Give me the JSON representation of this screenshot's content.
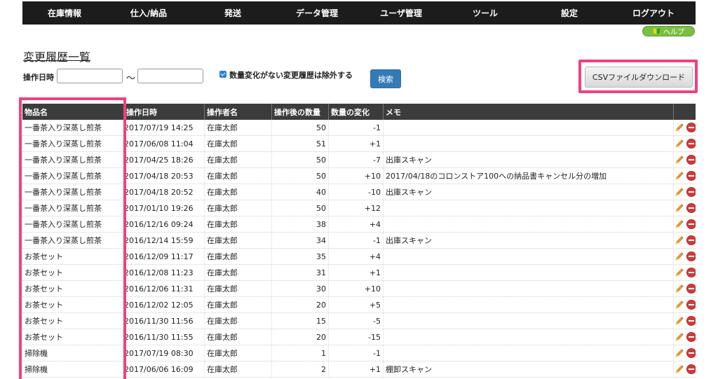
{
  "nav": {
    "items": [
      "在庫情報",
      "仕入/納品",
      "発送",
      "データ管理",
      "ユーザ管理",
      "ツール",
      "設定",
      "ログアウト"
    ]
  },
  "help": {
    "label": "ヘルプ"
  },
  "page": {
    "title": "変更履歴一覧"
  },
  "filter": {
    "date_label": "操作日時",
    "date_from_value": "",
    "date_to_value": "",
    "tilde": "〜",
    "exclude_checked": true,
    "exclude_label": "数量変化がない変更履歴は除外する",
    "search_label": "検索",
    "csv_label": "CSVファイルダウンロード"
  },
  "table": {
    "headers": [
      "物品名",
      "操作日時",
      "操作者名",
      "操作後の数量",
      "数量の変化",
      "メモ",
      ""
    ],
    "rows": [
      {
        "item": "一番茶入り深蒸し煎茶",
        "datetime": "2017/07/19 14:25",
        "operator": "在庫太郎",
        "qty": "50",
        "change": "-1",
        "memo": ""
      },
      {
        "item": "一番茶入り深蒸し煎茶",
        "datetime": "2017/06/08 11:04",
        "operator": "在庫太郎",
        "qty": "51",
        "change": "+1",
        "memo": ""
      },
      {
        "item": "一番茶入り深蒸し煎茶",
        "datetime": "2017/04/25 18:26",
        "operator": "在庫太郎",
        "qty": "50",
        "change": "-7",
        "memo": "出庫スキャン"
      },
      {
        "item": "一番茶入り深蒸し煎茶",
        "datetime": "2017/04/18 20:53",
        "operator": "在庫太郎",
        "qty": "50",
        "change": "+10",
        "memo": "2017/04/18のコロンストア100への納品書キャンセル分の増加"
      },
      {
        "item": "一番茶入り深蒸し煎茶",
        "datetime": "2017/04/18 20:52",
        "operator": "在庫太郎",
        "qty": "40",
        "change": "-10",
        "memo": "出庫スキャン"
      },
      {
        "item": "一番茶入り深蒸し煎茶",
        "datetime": "2017/01/10 19:26",
        "operator": "在庫太郎",
        "qty": "50",
        "change": "+12",
        "memo": ""
      },
      {
        "item": "一番茶入り深蒸し煎茶",
        "datetime": "2016/12/16 09:24",
        "operator": "在庫太郎",
        "qty": "38",
        "change": "+4",
        "memo": ""
      },
      {
        "item": "一番茶入り深蒸し煎茶",
        "datetime": "2016/12/14 15:59",
        "operator": "在庫太郎",
        "qty": "34",
        "change": "-1",
        "memo": "出庫スキャン"
      },
      {
        "item": "お茶セット",
        "datetime": "2016/12/09 11:17",
        "operator": "在庫太郎",
        "qty": "35",
        "change": "+4",
        "memo": ""
      },
      {
        "item": "お茶セット",
        "datetime": "2016/12/08 11:23",
        "operator": "在庫太郎",
        "qty": "31",
        "change": "+1",
        "memo": ""
      },
      {
        "item": "お茶セット",
        "datetime": "2016/12/06 11:31",
        "operator": "在庫太郎",
        "qty": "30",
        "change": "+10",
        "memo": ""
      },
      {
        "item": "お茶セット",
        "datetime": "2016/12/02 12:05",
        "operator": "在庫太郎",
        "qty": "20",
        "change": "+5",
        "memo": ""
      },
      {
        "item": "お茶セット",
        "datetime": "2016/11/30 11:56",
        "operator": "在庫太郎",
        "qty": "15",
        "change": "-5",
        "memo": ""
      },
      {
        "item": "お茶セット",
        "datetime": "2016/11/30 11:55",
        "operator": "在庫太郎",
        "qty": "20",
        "change": "-15",
        "memo": ""
      },
      {
        "item": "掃除機",
        "datetime": "2017/07/19 08:30",
        "operator": "在庫太郎",
        "qty": "1",
        "change": "-1",
        "memo": ""
      },
      {
        "item": "掃除機",
        "datetime": "2017/06/06 16:09",
        "operator": "在庫太郎",
        "qty": "2",
        "change": "+1",
        "memo": "棚卸スキャン"
      }
    ]
  },
  "icons": {
    "edit": "pencil-icon",
    "delete": "delete-icon",
    "help": "beginner-mark-icon"
  },
  "colors": {
    "nav_bg": "#1c1c1c",
    "header_bg": "#3c3c3c",
    "highlight": "#f0427a",
    "search": "#337ab7",
    "help": "#7bc043"
  }
}
